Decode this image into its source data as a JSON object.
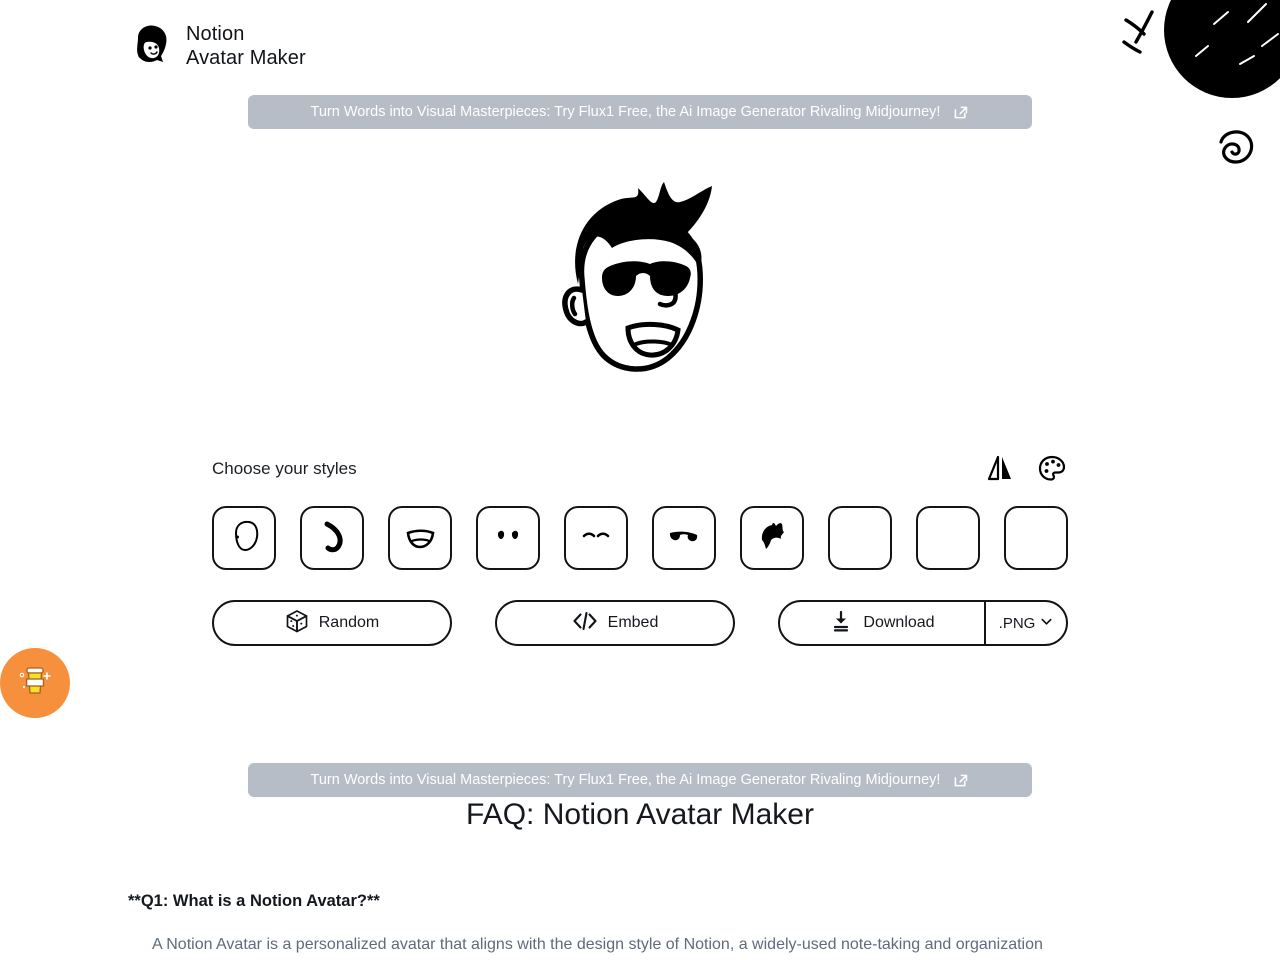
{
  "header": {
    "logo_icon": "notion-avatar-logo",
    "title_line1": "Notion",
    "title_line2": "Avatar Maker"
  },
  "promo": {
    "text": "Turn Words into Visual Masterpieces: Try Flux1 Free, the Ai Image Generator Rivaling Midjourney!",
    "icon": "external-link-icon",
    "background": "#b7bdc6",
    "text_color": "#ffffff"
  },
  "avatar": {
    "alt": "notion-style avatar with spiky hair, sunglasses and open smile"
  },
  "styles": {
    "title": "Choose your styles",
    "tools": [
      {
        "name": "flip-horizontal-icon",
        "label": "Flip"
      },
      {
        "name": "palette-icon",
        "label": "Colors"
      }
    ],
    "thumbs": [
      {
        "name": "face-shape",
        "icon": "face-outline-icon"
      },
      {
        "name": "nose",
        "icon": "nose-curve-icon"
      },
      {
        "name": "mouth",
        "icon": "mouth-smile-icon"
      },
      {
        "name": "eyes",
        "icon": "eyes-round-icon"
      },
      {
        "name": "eyebrows",
        "icon": "eyebrows-thin-icon"
      },
      {
        "name": "glasses",
        "icon": "sunglasses-icon"
      },
      {
        "name": "hair",
        "icon": "hair-spiky-icon"
      },
      {
        "name": "beard",
        "icon": "empty-icon"
      },
      {
        "name": "accessories",
        "icon": "empty-icon"
      },
      {
        "name": "details",
        "icon": "empty-icon"
      }
    ]
  },
  "actions": {
    "random": {
      "label": "Random",
      "icon": "dice-icon"
    },
    "embed": {
      "label": "Embed",
      "icon": "code-icon"
    },
    "download": {
      "label": "Download",
      "icon": "download-icon"
    },
    "format": {
      "value": ".PNG",
      "icon": "chevron-down-icon"
    }
  },
  "coffee": {
    "icon": "coffee-cup-icon",
    "background": "#f7903d"
  },
  "faq": {
    "title": "FAQ: Notion Avatar Maker",
    "question": "**Q1: What is a Notion Avatar?**",
    "answer": "A Notion Avatar is a personalized avatar that aligns with the design style of Notion, a widely-used note-taking and organization"
  }
}
